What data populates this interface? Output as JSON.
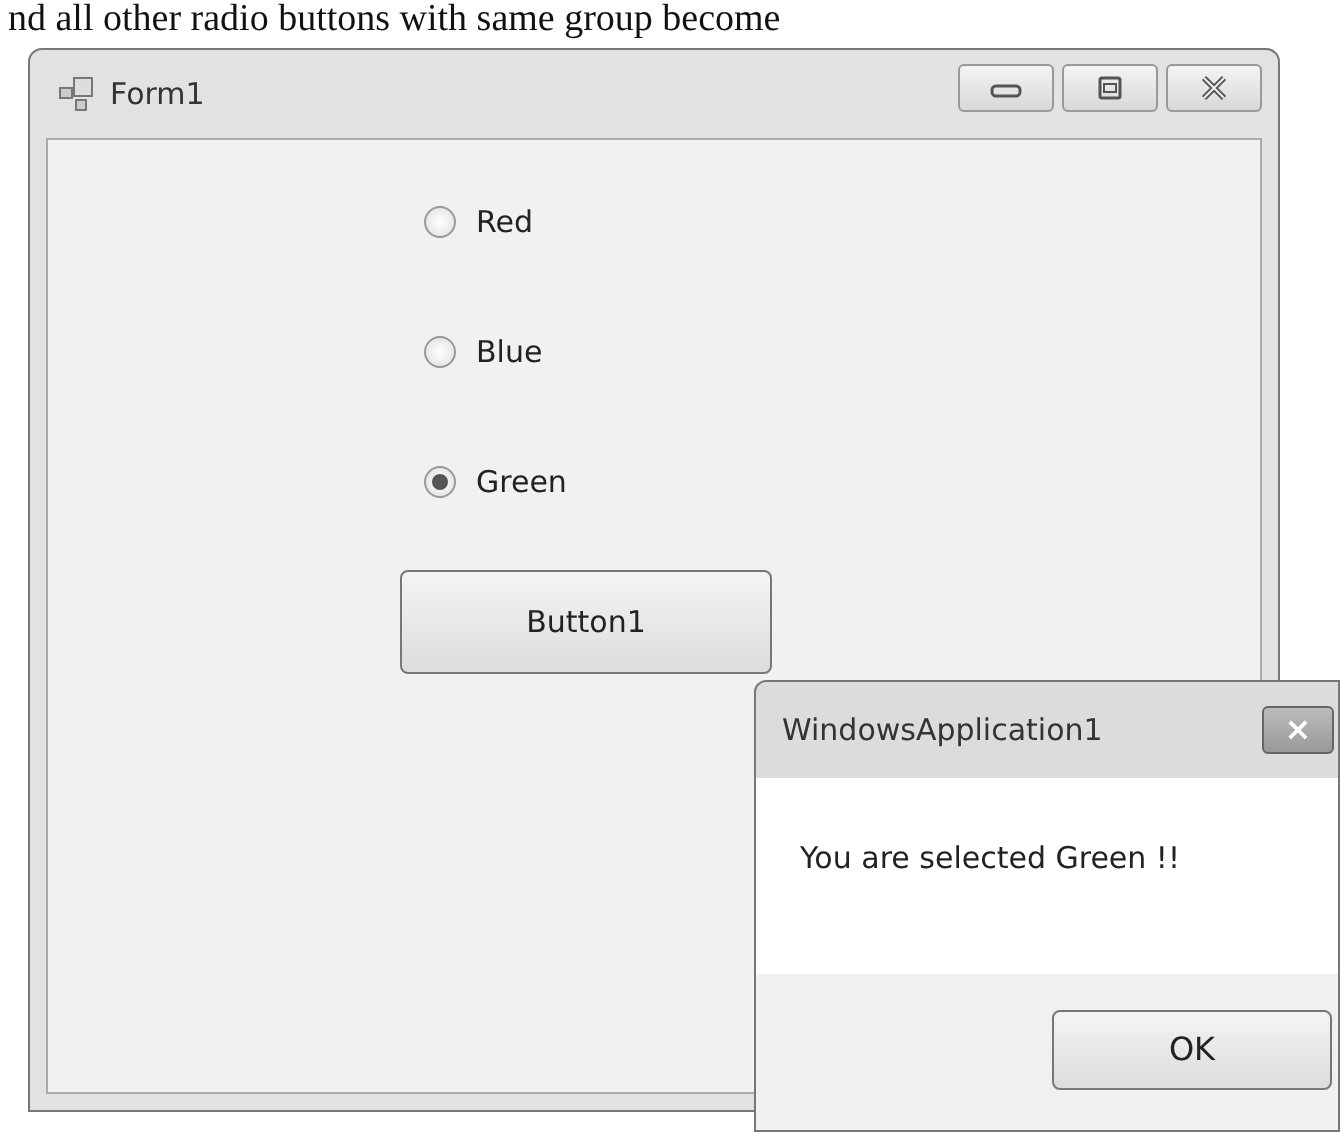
{
  "page_text": "nd all other radio buttons with same group become",
  "form": {
    "title": "Form1",
    "radios": [
      {
        "label": "Red",
        "selected": false
      },
      {
        "label": "Blue",
        "selected": false
      },
      {
        "label": "Green",
        "selected": true
      }
    ],
    "button": "Button1"
  },
  "dialog": {
    "title": "WindowsApplication1",
    "close": "×",
    "message": "You are selected Green !!",
    "button": "OK"
  }
}
